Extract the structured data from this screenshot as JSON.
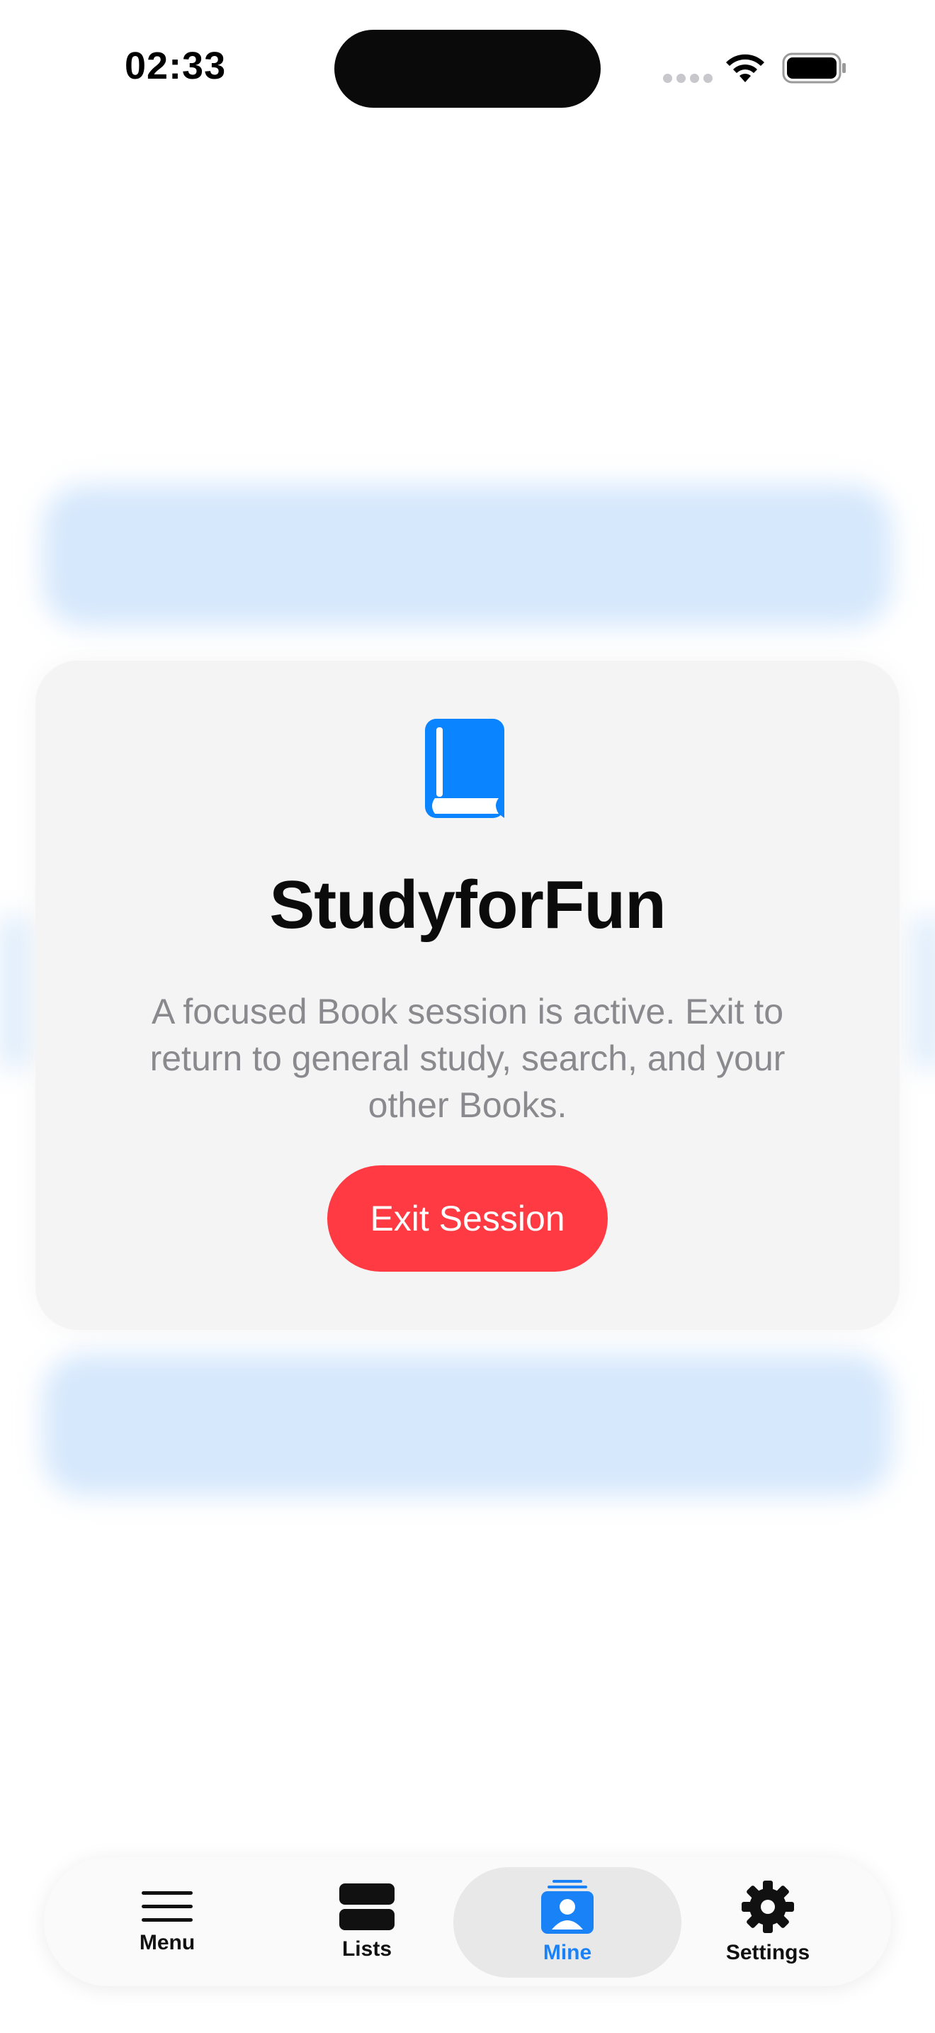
{
  "status_bar": {
    "time": "02:33"
  },
  "session": {
    "title": "StudyforFun",
    "description": "A focused Book session is active. Exit to return to general study, search, and your other Books.",
    "exit_label": "Exit Session"
  },
  "tab_bar": {
    "items": [
      {
        "label": "Menu",
        "icon": "menu-icon",
        "active": false
      },
      {
        "label": "Lists",
        "icon": "lists-icon",
        "active": false
      },
      {
        "label": "Mine",
        "icon": "mine-icon",
        "active": true
      },
      {
        "label": "Settings",
        "icon": "gear-icon",
        "active": false
      }
    ]
  },
  "colors": {
    "accent": "#1a82f7",
    "destructive": "#ff3a43",
    "card_background": "#f4f4f5",
    "blurred_cards": "#d6e8fc"
  }
}
